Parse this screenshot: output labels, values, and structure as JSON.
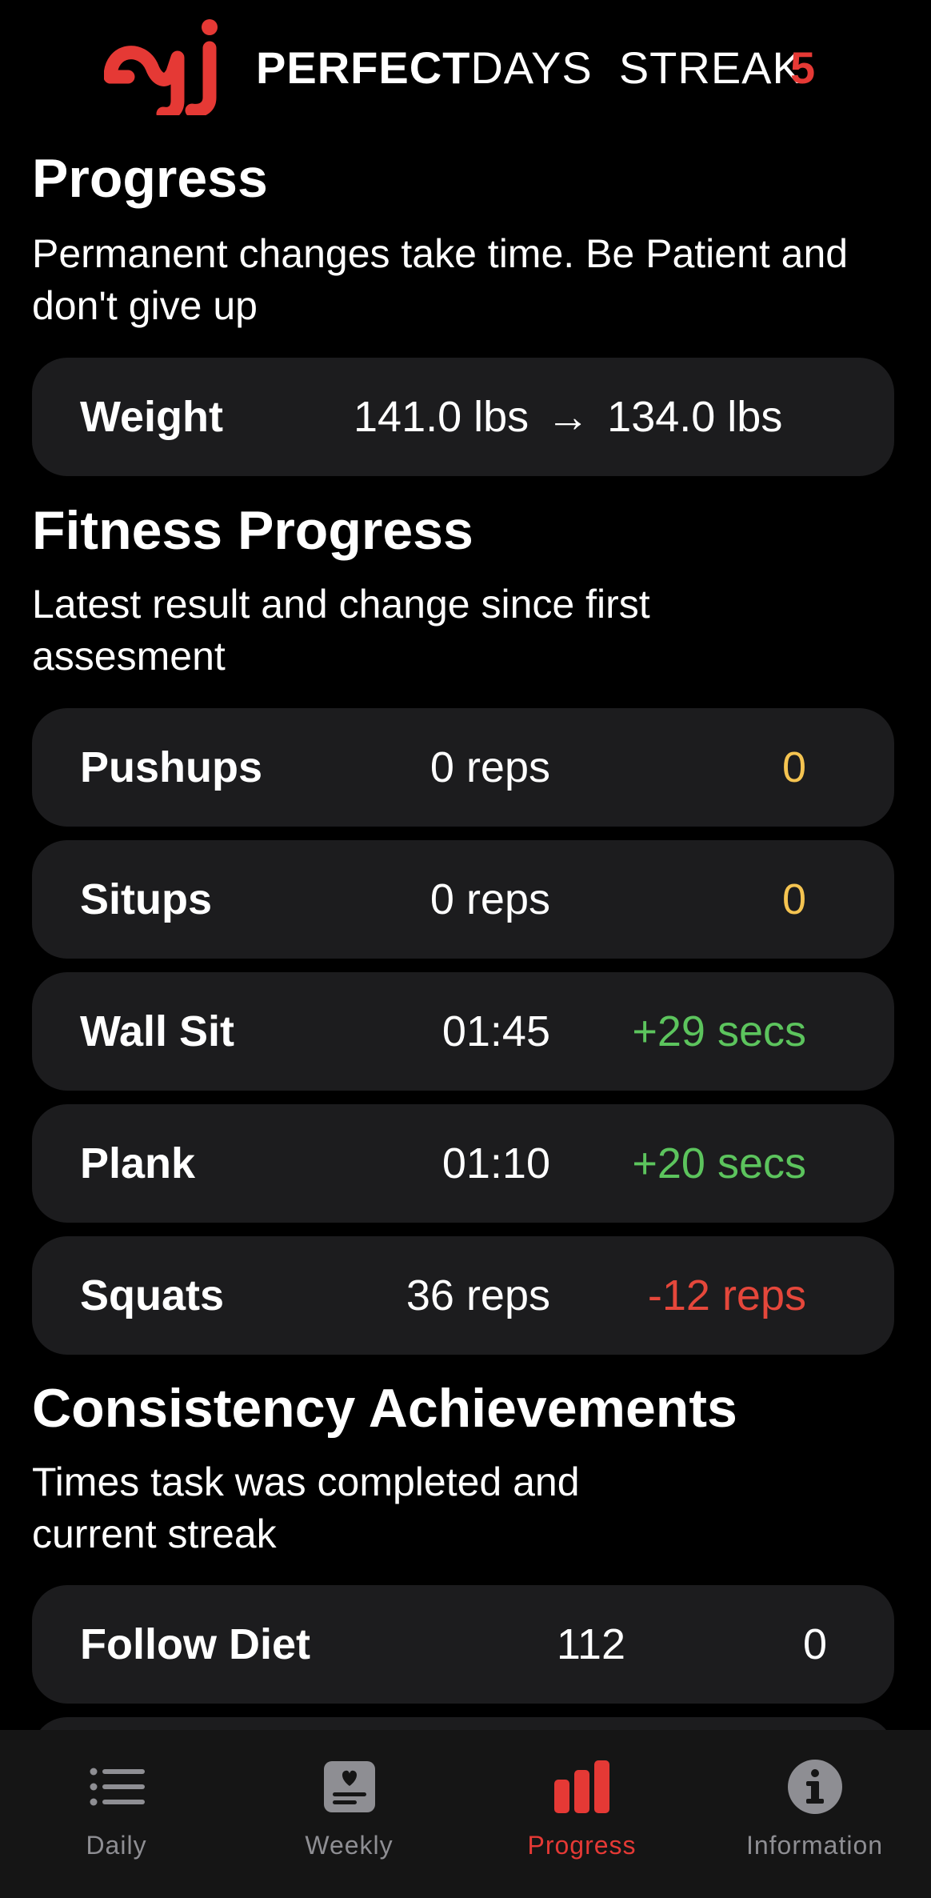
{
  "colors": {
    "background": "#000000",
    "card": "#1c1c1e",
    "brand_red": "#e53935",
    "neutral_yellow": "#f5c451",
    "positive_green": "#5cc45d",
    "negative_red": "#e5473b",
    "tab_inactive": "#8e8e93",
    "text": "#ffffff"
  },
  "header": {
    "logo_icon": "brand-logo",
    "brand_bold": "PERFECT",
    "brand_light": "DAYS  STREAK",
    "streak_count": "5"
  },
  "progress": {
    "title": "Progress",
    "subtitle": "Permanent changes take time. Be Patient and don't give up",
    "weight": {
      "label": "Weight",
      "start": "141.0 lbs",
      "arrow": "→",
      "current": "134.0 lbs"
    }
  },
  "fitness": {
    "title": "Fitness Progress",
    "subtitle": "Latest result and change since first assesment",
    "rows": [
      {
        "label": "Pushups",
        "value": "0 reps",
        "change": "0",
        "status": "neutral"
      },
      {
        "label": "Situps",
        "value": "0 reps",
        "change": "0",
        "status": "neutral"
      },
      {
        "label": "Wall Sit",
        "value": "01:45",
        "change": "+29 secs",
        "status": "positive"
      },
      {
        "label": "Plank",
        "value": "01:10",
        "change": "+20 secs",
        "status": "positive"
      },
      {
        "label": "Squats",
        "value": "36 reps",
        "change": "-12 reps",
        "status": "negative"
      }
    ]
  },
  "consistency": {
    "title": "Consistency Achievements",
    "subtitle": "Times task was completed and current streak",
    "rows": [
      {
        "label": "Follow Diet",
        "count": "112",
        "streak": "0"
      }
    ]
  },
  "tabbar": {
    "tabs": [
      {
        "label": "Daily",
        "icon": "list-icon",
        "active": false
      },
      {
        "label": "Weekly",
        "icon": "journal-icon",
        "active": false
      },
      {
        "label": "Progress",
        "icon": "bar-chart-icon",
        "active": true
      },
      {
        "label": "Information",
        "icon": "info-icon",
        "active": false
      }
    ]
  }
}
